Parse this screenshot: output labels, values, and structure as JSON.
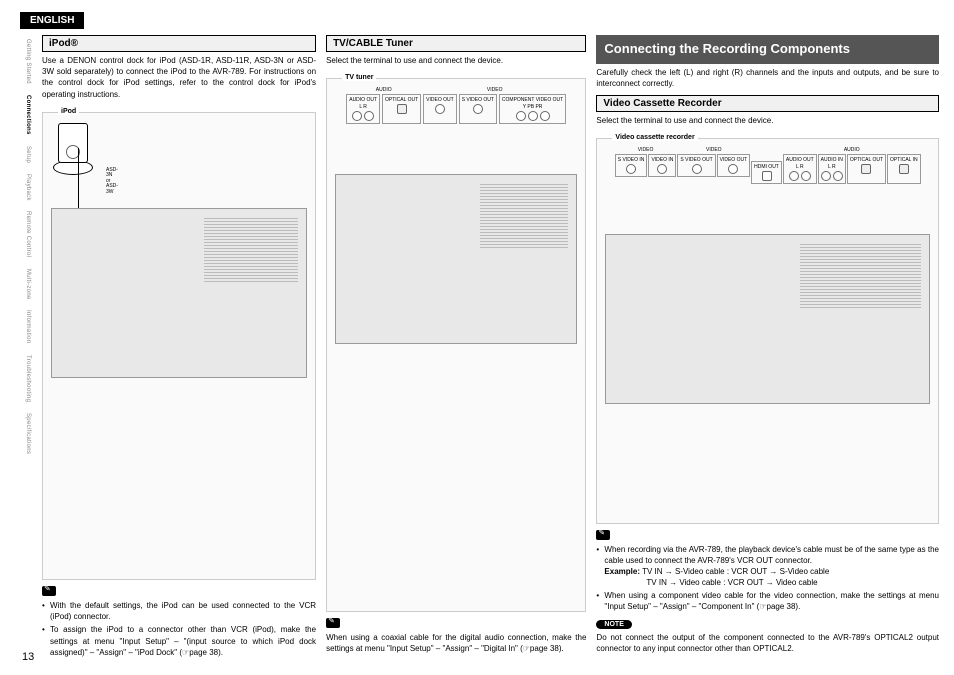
{
  "lang": "ENGLISH",
  "page_number": "13",
  "sidebar": {
    "items": [
      {
        "label": "Getting Started"
      },
      {
        "label": "Connections"
      },
      {
        "label": "Setup"
      },
      {
        "label": "Playback"
      },
      {
        "label": "Remote Control"
      },
      {
        "label": "Multi-zone"
      },
      {
        "label": "Information"
      },
      {
        "label": "Troubleshooting"
      },
      {
        "label": "Specifications"
      }
    ],
    "active_index": 1
  },
  "col1": {
    "header": "iPod®",
    "intro": "Use a DENON control dock for iPod (ASD-1R, ASD-11R, ASD-3N or ASD-3W sold separately) to connect the iPod to the AVR-789. For instructions on the control dock for iPod settings, refer to the control dock for iPod's operating instructions.",
    "diagram_label": "iPod",
    "device_note": "ASD-3N or ASD-3W",
    "bullets": [
      "With the default settings, the iPod can be used connected to the VCR (iPod) connector.",
      "To assign the iPod to a connector other than VCR (iPod), make the settings at menu \"Input Setup\" – \"(input source to which iPod dock assigned)\" – \"Assign\" – \"iPod Dock\" (☞page 38)."
    ]
  },
  "col2": {
    "header": "TV/CABLE Tuner",
    "intro": "Select the terminal to use and connect the device.",
    "diagram_label": "TV tuner",
    "groups": {
      "audio": "AUDIO",
      "video": "VIDEO"
    },
    "connectors": {
      "audio_out": "AUDIO OUT",
      "lr": "L   R",
      "optical_out": "OPTICAL OUT",
      "video_out": "VIDEO OUT",
      "svideo_out": "S VIDEO OUT",
      "component": "COMPONENT VIDEO OUT",
      "ypbpr": "Y   PB   PR"
    },
    "note_text": "When using a coaxial cable for the digital audio connection, make the settings at menu \"Input Setup\" – \"Assign\" – \"Digital In\" (☞page 38)."
  },
  "col3": {
    "major_header": "Connecting the Recording Components",
    "major_intro": "Carefully check the left (L) and right (R) channels and the inputs and outputs, and be sure to interconnect correctly.",
    "sub_header": "Video Cassette Recorder",
    "sub_intro": "Select the terminal to use and connect the device.",
    "diagram_label": "Video cassette recorder",
    "groups": {
      "video": "VIDEO",
      "audio": "AUDIO"
    },
    "connectors": {
      "svideo_in": "S VIDEO IN",
      "video_in": "VIDEO IN",
      "svideo_out": "S VIDEO OUT",
      "video_out": "VIDEO OUT",
      "hdmi_out": "HDMI OUT",
      "audio_out": "AUDIO OUT",
      "audio_in": "AUDIO IN",
      "optical_out": "OPTICAL OUT",
      "optical_in": "OPTICAL IN",
      "lr": "L   R"
    },
    "bullets": [
      "When recording via the AVR-789, the playback device's cable must be of the same type as the cable used to connect the AVR-789's VCR OUT connector.",
      "When using a component video cable for the video connection, make the settings at menu \"Input Setup\" – \"Assign\" – \"Component In\" (☞page 38)."
    ],
    "example_label": "Example:",
    "example_lines": [
      "TV IN → S-Video cable : VCR OUT → S-Video cable",
      "TV IN → Video cable : VCR OUT → Video cable"
    ],
    "note_label": "NOTE",
    "note_text": "Do not connect the output of the component connected to the AVR-789's OPTICAL2 output connector to any input connector other than OPTICAL2."
  }
}
